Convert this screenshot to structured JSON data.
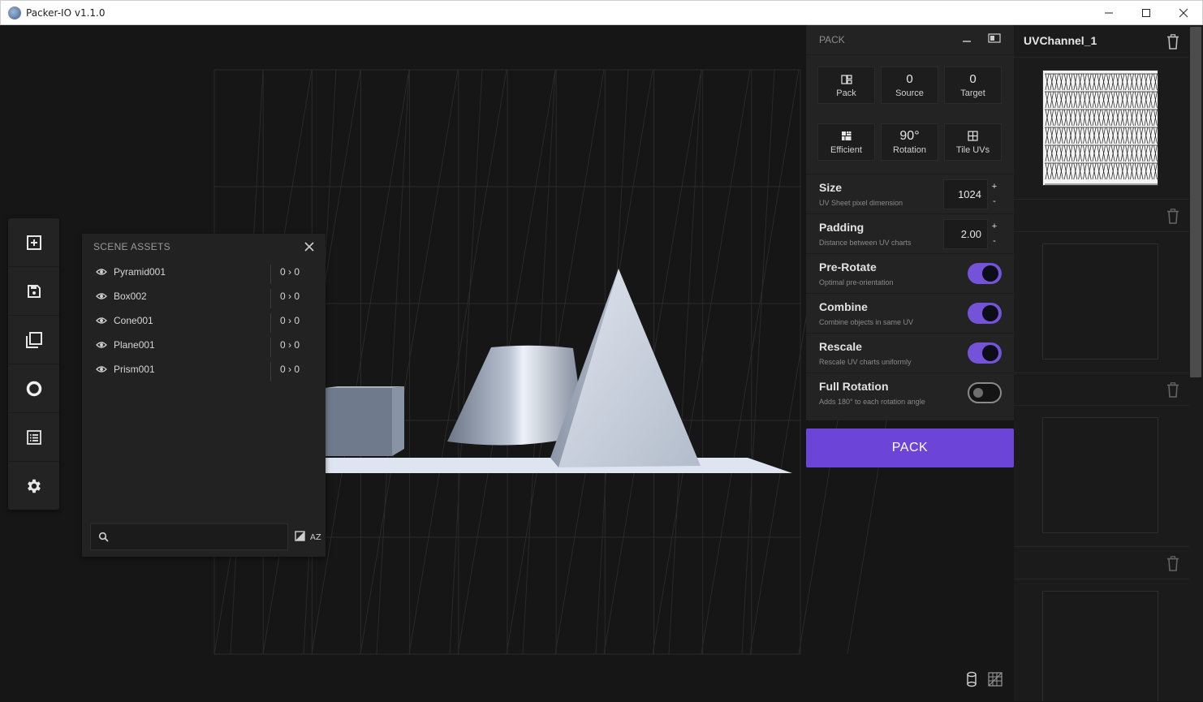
{
  "window": {
    "title": "Packer-IO v1.1.0",
    "icon": "app-logo-icon"
  },
  "toolbar": {
    "items": [
      {
        "icon": "add-box-icon"
      },
      {
        "icon": "save-icon"
      },
      {
        "icon": "copy-layers-icon"
      },
      {
        "icon": "circle-icon"
      },
      {
        "icon": "list-icon"
      },
      {
        "icon": "gear-icon"
      }
    ]
  },
  "scene_assets": {
    "title": "SCENE ASSETS",
    "items": [
      {
        "name": "Pyramid001",
        "count": "0 › 0"
      },
      {
        "name": "Box002",
        "count": "0 › 0"
      },
      {
        "name": "Cone001",
        "count": "0 › 0"
      },
      {
        "name": "Plane001",
        "count": "0 › 0"
      },
      {
        "name": "Prism001",
        "count": "0 › 0"
      }
    ],
    "search": {
      "value": "",
      "placeholder": ""
    }
  },
  "pack_panel": {
    "title": "PACK",
    "tiles": [
      {
        "value": "",
        "label": "Pack",
        "icon": "pack-icon"
      },
      {
        "value": "0",
        "label": "Source"
      },
      {
        "value": "0",
        "label": "Target"
      },
      {
        "value": "",
        "label": "Efficient",
        "icon": "efficient-icon"
      },
      {
        "value": "90°",
        "label": "Rotation"
      },
      {
        "value": "",
        "label": "Tile UVs",
        "icon": "tile-grid-icon"
      }
    ],
    "size": {
      "title": "Size",
      "desc": "UV Sheet pixel dimension",
      "value": "1024",
      "plus": "+",
      "minus": "-"
    },
    "padding": {
      "title": "Padding",
      "desc": "Distance between UV charts",
      "value": "2.00",
      "plus": "+",
      "minus": "-"
    },
    "toggles": [
      {
        "title": "Pre-Rotate",
        "desc": "Optimal pre-orientation",
        "on": true
      },
      {
        "title": "Combine",
        "desc": "Combine objects in same UV",
        "on": true
      },
      {
        "title": "Rescale",
        "desc": "Rescale UV charts uniformly",
        "on": true
      },
      {
        "title": "Full Rotation",
        "desc": "Adds 180° to each rotation angle",
        "on": false
      }
    ],
    "button_label": "PACK"
  },
  "uv_panel": {
    "channel_title": "UVChannel_1"
  },
  "colors": {
    "accent": "#6c45d8",
    "toggle_on": "#7453d8",
    "panel_bg": "#232323",
    "viewport_bg": "#161616"
  }
}
